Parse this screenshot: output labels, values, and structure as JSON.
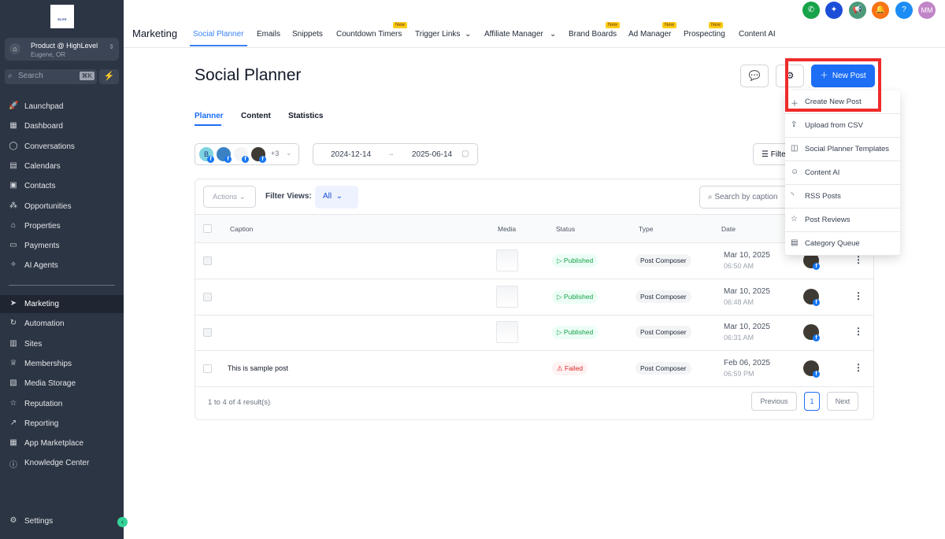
{
  "sidebar": {
    "logo_text": "ELITE CONNECTOR",
    "account_name": "Product @ HighLevel",
    "account_location": "Eugene, OR",
    "search_placeholder": "Search",
    "search_shortcut": "⌘K",
    "items": [
      {
        "label": "Launchpad",
        "icon": "rocket-icon"
      },
      {
        "label": "Dashboard",
        "icon": "dashboard-icon"
      },
      {
        "label": "Conversations",
        "icon": "chat-icon"
      },
      {
        "label": "Calendars",
        "icon": "calendar-icon"
      },
      {
        "label": "Contacts",
        "icon": "contacts-icon"
      },
      {
        "label": "Opportunities",
        "icon": "opportunities-icon"
      },
      {
        "label": "Properties",
        "icon": "home-icon"
      },
      {
        "label": "Payments",
        "icon": "payments-icon"
      },
      {
        "label": "AI Agents",
        "icon": "ai-icon"
      }
    ],
    "items2": [
      {
        "label": "Marketing",
        "icon": "send-icon"
      },
      {
        "label": "Automation",
        "icon": "automation-icon"
      },
      {
        "label": "Sites",
        "icon": "sites-icon"
      },
      {
        "label": "Memberships",
        "icon": "memberships-icon"
      },
      {
        "label": "Media Storage",
        "icon": "media-icon"
      },
      {
        "label": "Reputation",
        "icon": "star-icon"
      },
      {
        "label": "Reporting",
        "icon": "chart-icon"
      },
      {
        "label": "App Marketplace",
        "icon": "apps-icon"
      },
      {
        "label": "Knowledge Center",
        "icon": "info-icon"
      }
    ],
    "settings": "Settings"
  },
  "topbar": {
    "avatar_initials": "MM",
    "help": "?"
  },
  "header": {
    "section": "Marketing",
    "new_badge": "New",
    "tabs": [
      "Social Planner",
      "Emails",
      "Snippets",
      "Countdown Timers",
      "Trigger Links",
      "Affiliate Manager",
      "Brand Boards",
      "Ad Manager",
      "Prospecting",
      "Content AI"
    ]
  },
  "page": {
    "title": "Social Planner",
    "new_post": "New Post",
    "tabs": [
      "Planner",
      "Content",
      "Statistics"
    ],
    "accounts_more": "+3",
    "account_initial": "B",
    "date_from": "2024-12-14",
    "date_to": "2025-06-14",
    "filters": "Filters",
    "actions": "Actions",
    "filter_views_label": "Filter Views:",
    "filter_view_value": "All",
    "search_placeholder": "Search by caption"
  },
  "menu": [
    "Create New Post",
    "Upload from CSV",
    "Social Planner Templates",
    "Content AI",
    "RSS Posts",
    "Post Reviews",
    "Category Queue"
  ],
  "table": {
    "headers": [
      "Caption",
      "Media",
      "Status",
      "Type",
      "Date"
    ],
    "rows": [
      {
        "caption": "",
        "status": "Published",
        "type": "Post Composer",
        "date": "Mar 10, 2025",
        "time": "06:50 AM"
      },
      {
        "caption": "",
        "status": "Published",
        "type": "Post Composer",
        "date": "Mar 10, 2025",
        "time": "06:48 AM"
      },
      {
        "caption": "",
        "status": "Published",
        "type": "Post Composer",
        "date": "Mar 10, 2025",
        "time": "06:31 AM"
      },
      {
        "caption": "This is sample post",
        "status": "Failed",
        "type": "Post Composer",
        "date": "Feb 06, 2025",
        "time": "06:59 PM"
      }
    ],
    "summary": "1 to 4 of 4 result(s)",
    "prev": "Previous",
    "page": "1",
    "next": "Next"
  },
  "colors": {
    "accent": "#1d6ef5",
    "sidebar": "#2c3543",
    "published": "#16a34a",
    "failed": "#dc2626",
    "highlight": "#ef2b2b"
  }
}
